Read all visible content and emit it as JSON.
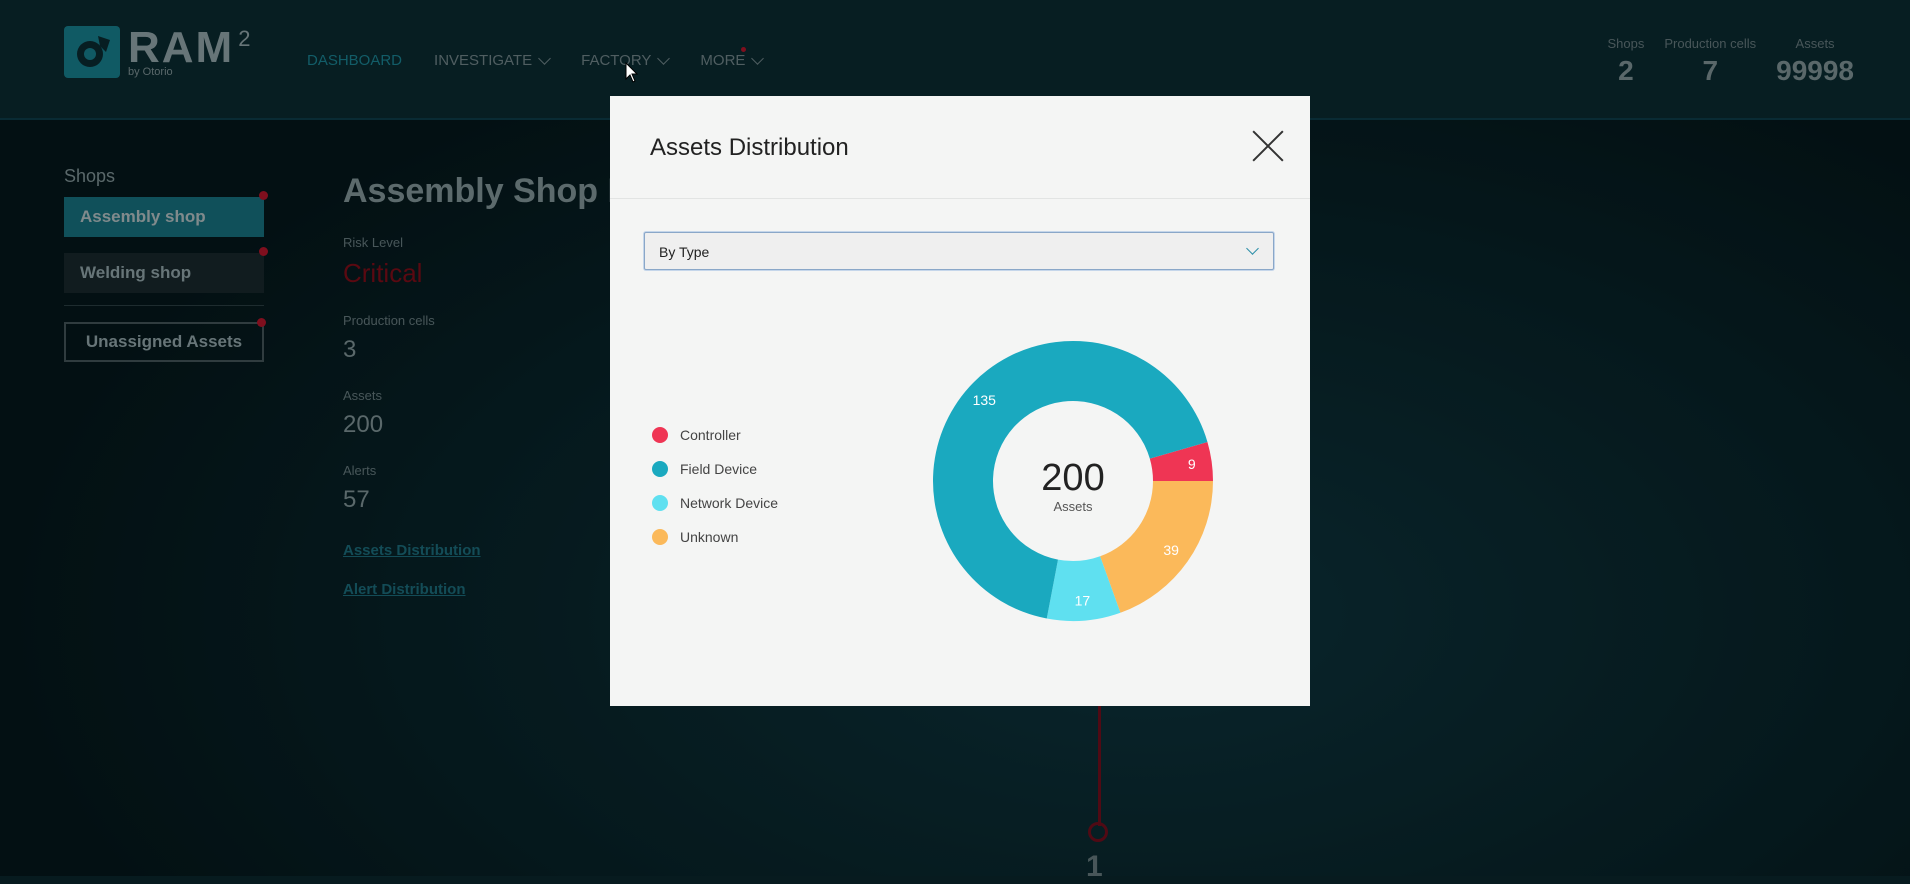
{
  "app": {
    "logo": {
      "name": "RAM",
      "superscript": "2",
      "byline": "by Otorio"
    },
    "nav": [
      {
        "label": "DASHBOARD",
        "active": true
      },
      {
        "label": "INVESTIGATE"
      },
      {
        "label": "FACTORY"
      },
      {
        "label": "MORE"
      }
    ],
    "stats": [
      {
        "label": "Shops",
        "value": "2"
      },
      {
        "label": "Production cells",
        "value": "7"
      },
      {
        "label": "Assets",
        "value": "99998"
      }
    ]
  },
  "sidebar": {
    "title": "Shops",
    "shops": [
      {
        "label": "Assembly shop",
        "active": true
      },
      {
        "label": "Welding shop"
      }
    ],
    "unassigned": "Unassigned Assets"
  },
  "details": {
    "title": "Assembly Shop R",
    "risk_label": "Risk Level",
    "risk_value": "Critical",
    "cells_label": "Production cells",
    "cells_value": "3",
    "assets_label": "Assets",
    "assets_value": "200",
    "alerts_label": "Alerts",
    "alerts_value": "57",
    "link_assets": "Assets Distribution",
    "link_alerts": "Alert Distribution"
  },
  "node": {
    "label": "1"
  },
  "modal": {
    "title": "Assets Distribution",
    "select_value": "By Type",
    "center_value": "200",
    "center_label": "Assets"
  },
  "colors": {
    "controller": "#ef3554",
    "field": "#1aa9bf",
    "network": "#5fe0f0",
    "unknown": "#fbb95a",
    "brand": "#1a8a9a"
  },
  "chart_data": {
    "type": "pie",
    "series": [
      {
        "name": "Controller",
        "value": 9,
        "color": "#ef3554"
      },
      {
        "name": "Unknown",
        "value": 39,
        "color": "#fbb95a"
      },
      {
        "name": "Network Device",
        "value": 17,
        "color": "#5fe0f0"
      },
      {
        "name": "Field Device",
        "value": 135,
        "color": "#1aa9bf"
      }
    ],
    "legend": [
      "Controller",
      "Field Device",
      "Network Device",
      "Unknown"
    ],
    "legend_position": "left",
    "total": 200
  }
}
